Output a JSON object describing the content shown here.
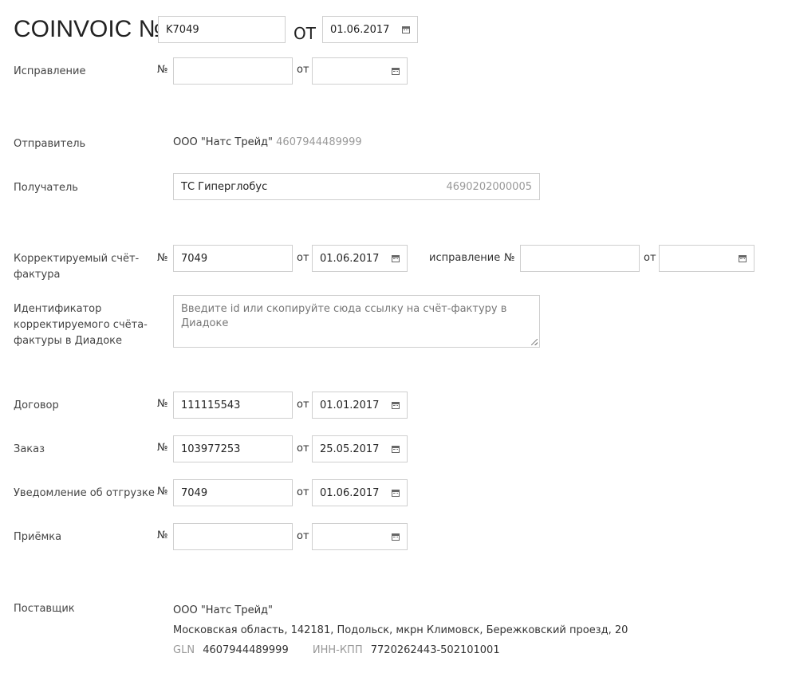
{
  "header": {
    "title": "COINVOIC №",
    "number_value": "K7049",
    "ot_label": "ОТ",
    "date_value": "01.06.2017"
  },
  "correction": {
    "label": "Исправление",
    "num_prefix": "№",
    "number_value": "",
    "ot_label": "от",
    "date_value": ""
  },
  "sender": {
    "label": "Отправитель",
    "name": "ООО \"Натс Трейд\"",
    "gln": "4607944489999"
  },
  "recipient": {
    "label": "Получатель",
    "name": "ТС Гиперглобус",
    "gln": "4690202000005"
  },
  "corrected_invoice": {
    "label_line1": "Корректируемый счёт-",
    "label_line2": "фактура",
    "num_prefix": "№",
    "number_value": "7049",
    "ot_label": "от",
    "date_value": "01.06.2017",
    "correction_label": "исправление",
    "correction_num_prefix": "№",
    "correction_number_value": "",
    "correction_ot_label": "от",
    "correction_date_value": ""
  },
  "identifier": {
    "label_line1": "Идентификатор",
    "label_line2": "корректируемого счёта-",
    "label_line3": "фактуры в Диадоке",
    "placeholder": "Введите id или скопируйте сюда ссылку на счёт-фактуру в Диадоке"
  },
  "contract": {
    "label": "Договор",
    "num_prefix": "№",
    "number_value": "111115543",
    "ot_label": "от",
    "date_value": "01.01.2017"
  },
  "order": {
    "label": "Заказ",
    "num_prefix": "№",
    "number_value": "103977253",
    "ot_label": "от",
    "date_value": "25.05.2017"
  },
  "shipment_notice": {
    "label": "Уведомление об отгрузке",
    "num_prefix": "№",
    "number_value": "7049",
    "ot_label": "от",
    "date_value": "01.06.2017"
  },
  "acceptance": {
    "label": "Приёмка",
    "num_prefix": "№",
    "number_value": "",
    "ot_label": "от",
    "date_value": ""
  },
  "supplier": {
    "label": "Поставщик",
    "name": "ООО \"Натс Трейд\"",
    "address": "Московская область, 142181, Подольск, мкрн Климовск, Бережковский проезд, 20",
    "gln_label": "GLN",
    "gln_value": "4607944489999",
    "inn_kpp_label": "ИНН-КПП",
    "inn_kpp_value": "7720262443-502101001"
  },
  "icons": {
    "calendar": "calendar-icon"
  }
}
